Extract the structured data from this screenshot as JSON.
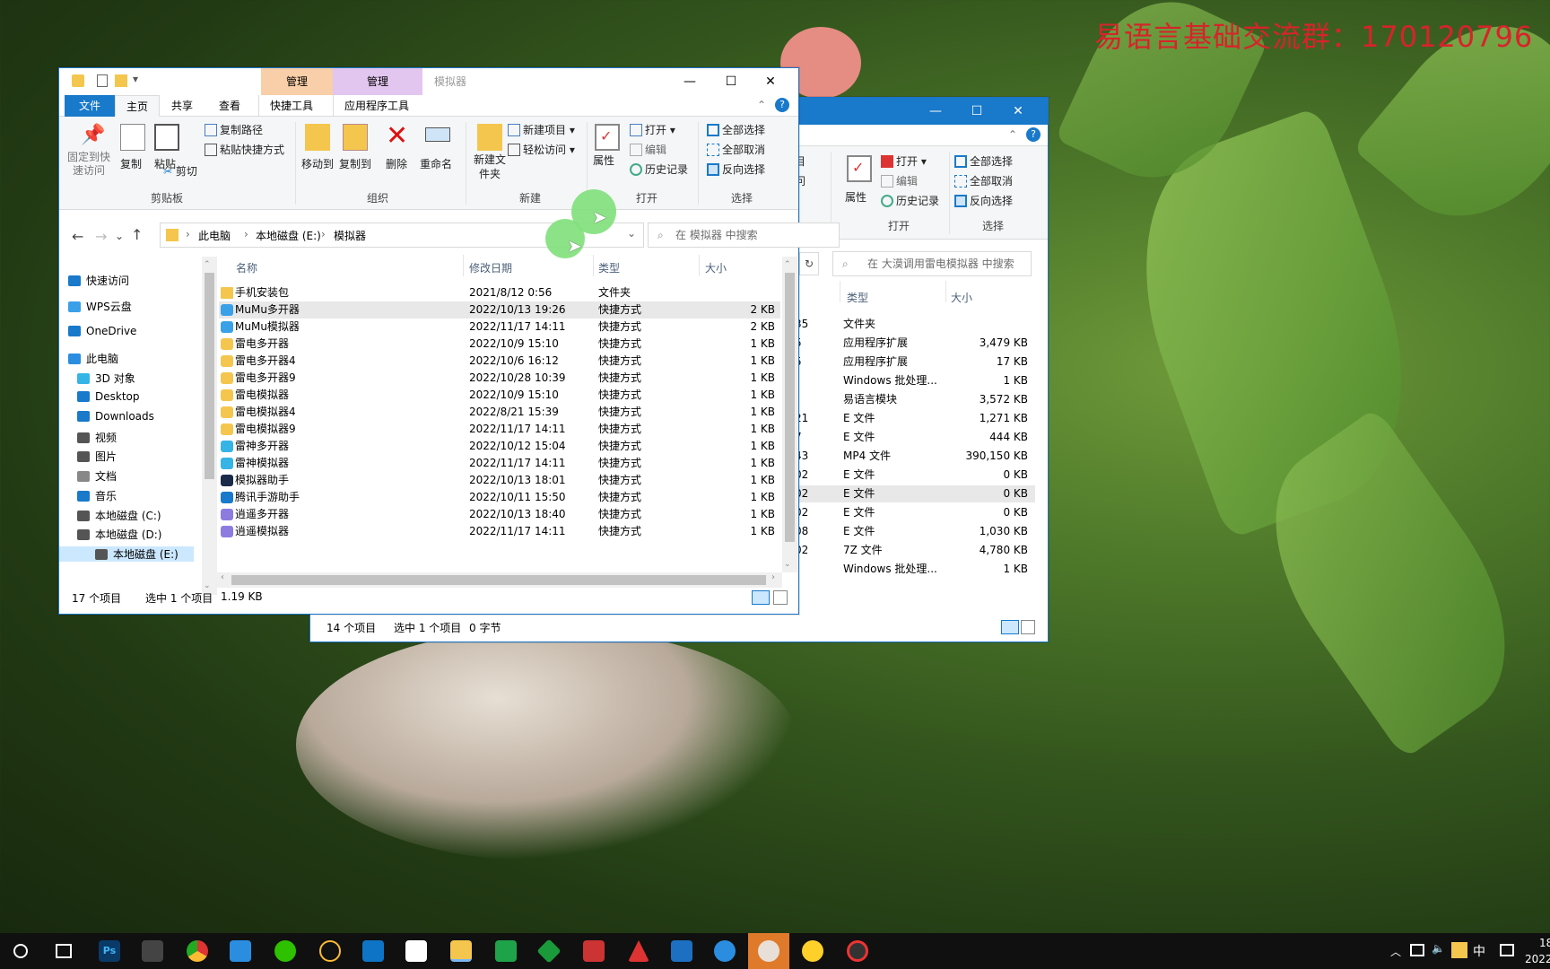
{
  "watermark": "易语言基础交流群：170120796",
  "win1": {
    "title": "模拟器",
    "context_tabs": [
      "管理",
      "管理"
    ],
    "ribbon_tabs": [
      "文件",
      "主页",
      "共享",
      "查看",
      "快捷工具",
      "应用程序工具"
    ],
    "clipboard": {
      "pin": "固定到快速访问",
      "copy": "复制",
      "paste": "粘贴",
      "copy_path": "复制路径",
      "paste_shortcut": "粘贴快捷方式",
      "cut": "剪切",
      "label": "剪贴板"
    },
    "organize": {
      "move_to": "移动到",
      "copy_to": "复制到",
      "delete": "删除",
      "rename": "重命名",
      "label": "组织"
    },
    "new": {
      "new_folder": "新建文件夹",
      "new_item": "新建项目",
      "easy_access": "轻松访问",
      "label": "新建"
    },
    "open": {
      "properties": "属性",
      "open": "打开",
      "edit": "编辑",
      "history": "历史记录",
      "label": "打开"
    },
    "select": {
      "select_all": "全部选择",
      "select_none": "全部取消",
      "invert": "反向选择",
      "label": "选择"
    },
    "breadcrumb": [
      "此电脑",
      "本地磁盘 (E:)",
      "模拟器"
    ],
    "search_placeholder": "在 模拟器 中搜索",
    "nav": [
      {
        "label": "快速访问",
        "icon": "star-icon"
      },
      {
        "label": "WPS云盘",
        "icon": "cloud-icon"
      },
      {
        "label": "OneDrive",
        "icon": "cloud-icon"
      },
      {
        "label": "此电脑",
        "icon": "computer-icon"
      },
      {
        "label": "3D 对象",
        "icon": "cube-icon"
      },
      {
        "label": "Desktop",
        "icon": "desktop-icon"
      },
      {
        "label": "Downloads",
        "icon": "download-icon"
      },
      {
        "label": "视频",
        "icon": "video-icon"
      },
      {
        "label": "图片",
        "icon": "picture-icon"
      },
      {
        "label": "文档",
        "icon": "document-icon"
      },
      {
        "label": "音乐",
        "icon": "music-icon"
      },
      {
        "label": "本地磁盘 (C:)",
        "icon": "drive-icon"
      },
      {
        "label": "本地磁盘 (D:)",
        "icon": "drive-icon"
      },
      {
        "label": "本地磁盘 (E:)",
        "icon": "drive-icon"
      }
    ],
    "columns": [
      "名称",
      "修改日期",
      "类型",
      "大小"
    ],
    "files": [
      {
        "name": "手机安装包",
        "date": "2021/8/12 0:56",
        "type": "文件夹",
        "size": ""
      },
      {
        "name": "MuMu多开器",
        "date": "2022/10/13 19:26",
        "type": "快捷方式",
        "size": "2 KB"
      },
      {
        "name": "MuMu模拟器",
        "date": "2022/11/17 14:11",
        "type": "快捷方式",
        "size": "2 KB"
      },
      {
        "name": "雷电多开器",
        "date": "2022/10/9 15:10",
        "type": "快捷方式",
        "size": "1 KB"
      },
      {
        "name": "雷电多开器4",
        "date": "2022/10/6 16:12",
        "type": "快捷方式",
        "size": "1 KB"
      },
      {
        "name": "雷电多开器9",
        "date": "2022/10/28 10:39",
        "type": "快捷方式",
        "size": "1 KB"
      },
      {
        "name": "雷电模拟器",
        "date": "2022/10/9 15:10",
        "type": "快捷方式",
        "size": "1 KB"
      },
      {
        "name": "雷电模拟器4",
        "date": "2022/8/21 15:39",
        "type": "快捷方式",
        "size": "1 KB"
      },
      {
        "name": "雷电模拟器9",
        "date": "2022/11/17 14:11",
        "type": "快捷方式",
        "size": "1 KB"
      },
      {
        "name": "雷神多开器",
        "date": "2022/10/12 15:04",
        "type": "快捷方式",
        "size": "1 KB"
      },
      {
        "name": "雷神模拟器",
        "date": "2022/11/17 14:11",
        "type": "快捷方式",
        "size": "1 KB"
      },
      {
        "name": "模拟器助手",
        "date": "2022/10/13 18:01",
        "type": "快捷方式",
        "size": "1 KB"
      },
      {
        "name": "腾讯手游助手",
        "date": "2022/10/11 15:50",
        "type": "快捷方式",
        "size": "1 KB"
      },
      {
        "name": "逍遥多开器",
        "date": "2022/10/13 18:40",
        "type": "快捷方式",
        "size": "1 KB"
      },
      {
        "name": "逍遥模拟器",
        "date": "2022/11/17 14:11",
        "type": "快捷方式",
        "size": "1 KB"
      }
    ],
    "status_count": "17 个项目",
    "status_selected": "选中 1 个项目",
    "status_size": "1.19 KB"
  },
  "win2": {
    "search_placeholder": "在 大漠调用雷电模拟器 中搜索",
    "partial_ribbon": [
      "目",
      "问"
    ],
    "open": {
      "properties": "属性",
      "open": "打开",
      "edit": "编辑",
      "history": "历史记录",
      "label": "打开"
    },
    "select": {
      "select_all": "全部选择",
      "select_none": "全部取消",
      "invert": "反向选择",
      "label": "选择"
    },
    "columns": [
      "类型",
      "大小"
    ],
    "rows": [
      {
        "frag": "35",
        "type": "文件夹",
        "size": ""
      },
      {
        "frag": "5",
        "type": "应用程序扩展",
        "size": "3,479 KB"
      },
      {
        "frag": "5",
        "type": "应用程序扩展",
        "size": "17 KB"
      },
      {
        "frag": "",
        "type": "Windows 批处理...",
        "size": "1 KB"
      },
      {
        "frag": "",
        "type": "易语言模块",
        "size": "3,572 KB"
      },
      {
        "frag": "21",
        "type": "E 文件",
        "size": "1,271 KB"
      },
      {
        "frag": "7",
        "type": "E 文件",
        "size": "444 KB"
      },
      {
        "frag": "43",
        "type": "MP4 文件",
        "size": "390,150 KB"
      },
      {
        "frag": "02",
        "type": "E 文件",
        "size": "0 KB"
      },
      {
        "frag": "02",
        "type": "E 文件",
        "size": "0 KB"
      },
      {
        "frag": "02",
        "type": "E 文件",
        "size": "0 KB"
      },
      {
        "frag": "08",
        "type": "E 文件",
        "size": "1,030 KB"
      },
      {
        "frag": "02",
        "type": "7Z 文件",
        "size": "4,780 KB"
      },
      {
        "frag": "",
        "type": "Windows 批处理...",
        "size": "1 KB"
      }
    ],
    "status_count": "14 个项目",
    "status_selected": "选中 1 个项目",
    "status_size": "0 字节"
  },
  "taskbar": {
    "ime": "中",
    "clock_time": "18",
    "clock_date": "2022"
  }
}
